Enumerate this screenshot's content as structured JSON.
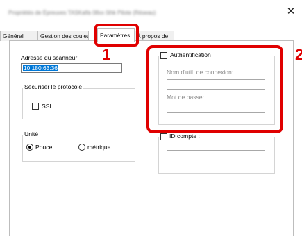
{
  "window": {
    "title": "Propriétés de Épreuves TASKalfa 08xx 0ihk Pilote (Réseau)",
    "close_glyph": "✕"
  },
  "tabs": [
    {
      "label": "Général"
    },
    {
      "label": "Gestion des couleurs"
    },
    {
      "label": "Paramètres"
    },
    {
      "label": "À propos de"
    }
  ],
  "scanner": {
    "label": "Adresse du scanneur:",
    "value": "10:180:63:36"
  },
  "secure_protocol": {
    "group_title": "Sécuriser le protocole",
    "ssl_label": "SSL",
    "ssl_checked": false
  },
  "unit": {
    "group_title": "Unité",
    "options": [
      {
        "label": "Pouce",
        "checked": true
      },
      {
        "label": "métrique",
        "checked": false
      }
    ]
  },
  "authentication": {
    "label": "Authentification",
    "checked": false,
    "username_label": "Nom d'util. de connexion:",
    "username_value": "",
    "password_label": "Mot de passe:",
    "password_value": ""
  },
  "account": {
    "label": "ID compte :",
    "checked": false,
    "value": ""
  },
  "annotations": {
    "marker_1": "1",
    "marker_2": "2",
    "color": "#e00000"
  }
}
